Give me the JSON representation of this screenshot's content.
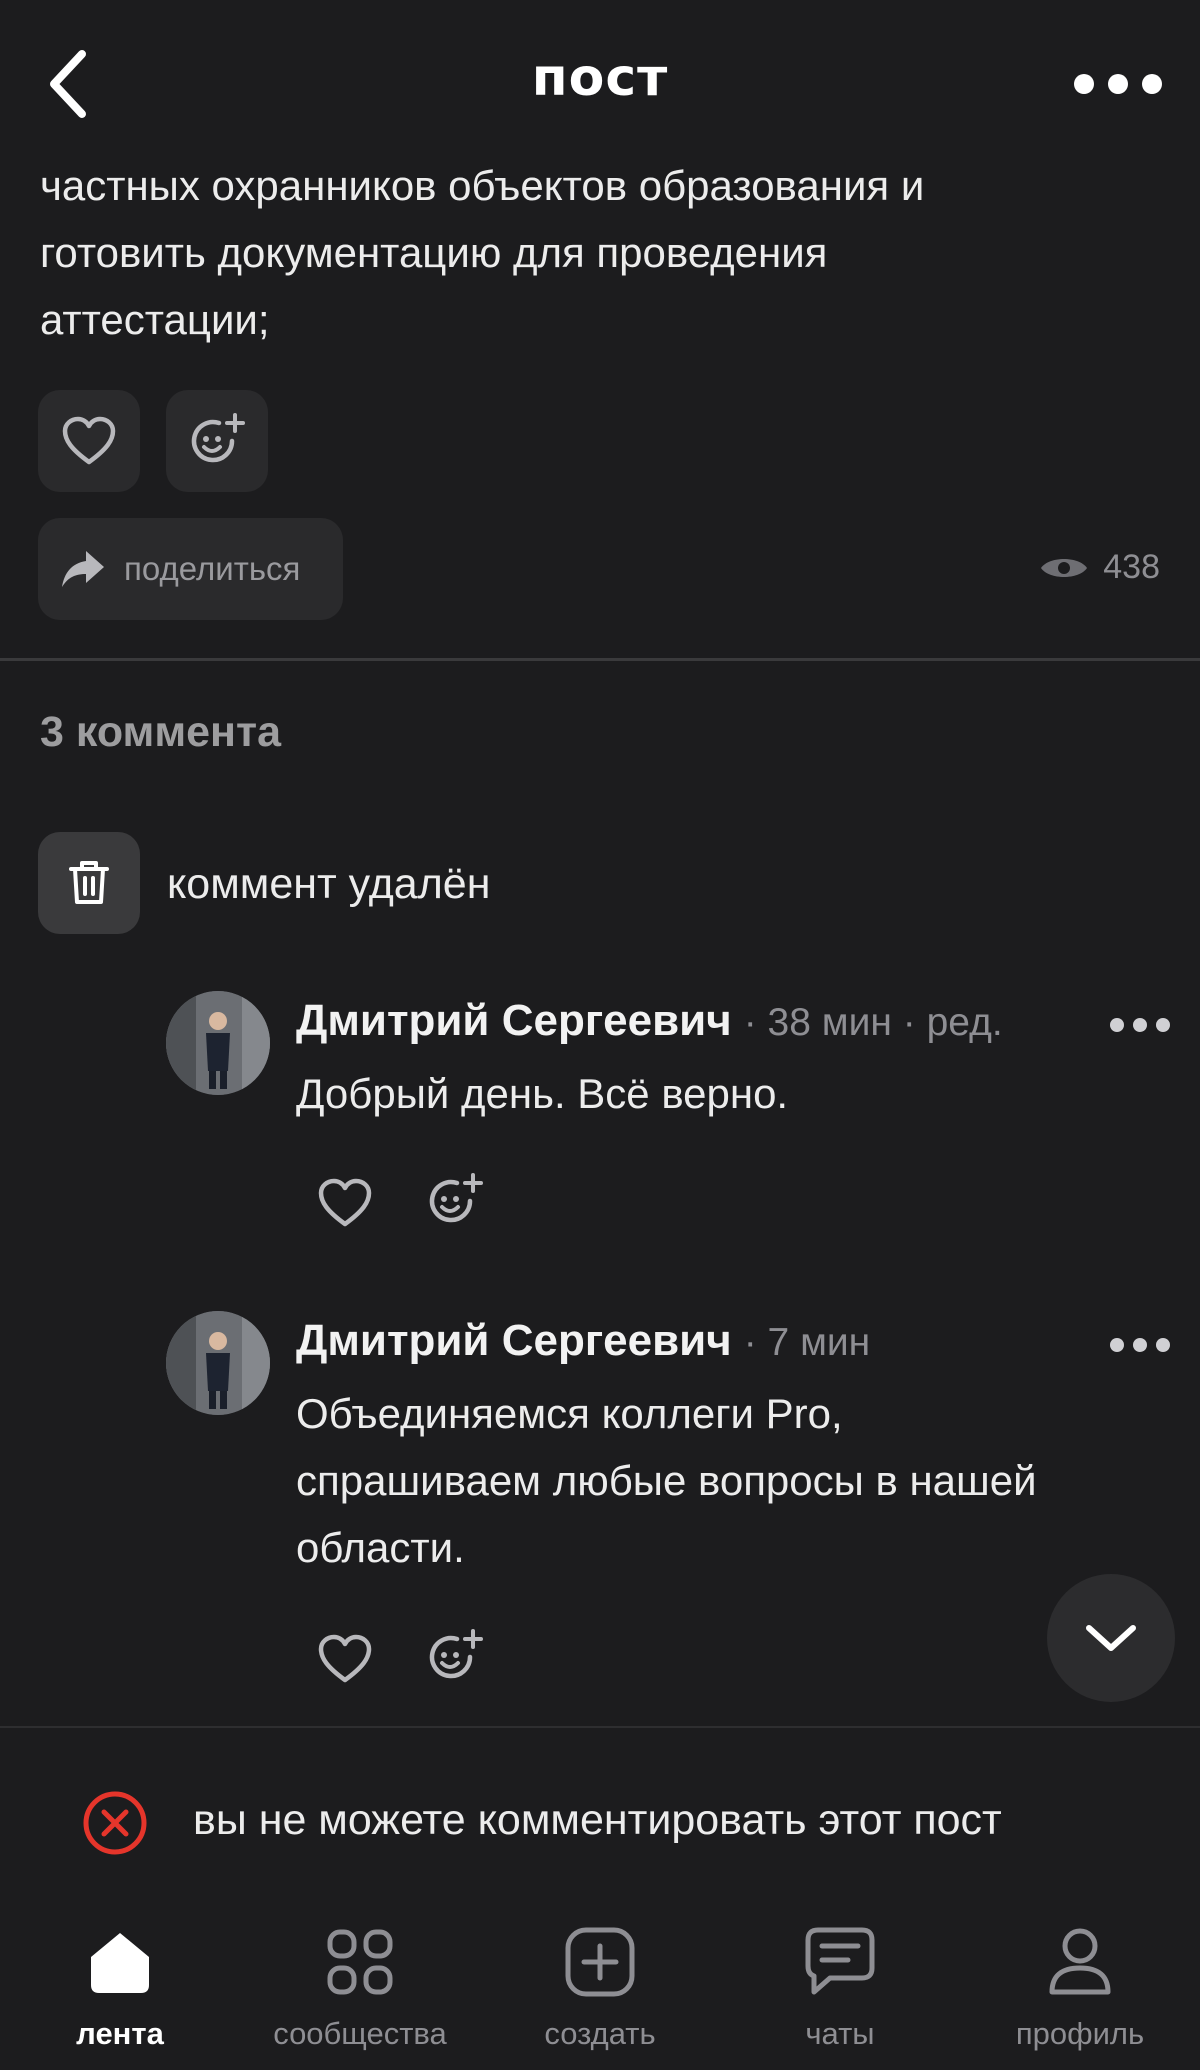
{
  "header": {
    "title": "пост",
    "back_icon": "chevron-left-icon",
    "more_icon": "more-dots-icon"
  },
  "post": {
    "text_lines": [
      "частных охранников объектов образования и",
      "готовить документацию для проведения",
      "аттестации;"
    ],
    "share_label": "поделиться",
    "views": "438"
  },
  "comments": {
    "count_label": "3 коммента",
    "deleted_label": "коммент удалён",
    "items": [
      {
        "author": "Дмитрий Сергеевич",
        "meta": "· 38 мин · ред.",
        "lines": [
          "Добрый день. Всё верно."
        ]
      },
      {
        "author": "Дмитрий Сергеевич",
        "meta": "· 7 мин",
        "lines": [
          "Объединяемся коллеги Pro,",
          "спрашиваем любые вопросы в нашей",
          "области."
        ]
      }
    ]
  },
  "banner": {
    "text": "вы не можете комментировать этот пост",
    "icon": "error-x-circle-icon",
    "icon_color": "#e5352b"
  },
  "nav": {
    "items": [
      {
        "label": "лента",
        "icon": "home-icon",
        "active": true
      },
      {
        "label": "сообщества",
        "icon": "grid-icon",
        "active": false
      },
      {
        "label": "создать",
        "icon": "plus-square-icon",
        "active": false
      },
      {
        "label": "чаты",
        "icon": "chat-icon",
        "active": false
      },
      {
        "label": "профиль",
        "icon": "profile-icon",
        "active": false
      }
    ]
  },
  "colors": {
    "background": "#1c1c1e",
    "surface": "#2a2a2c",
    "muted_text": "#8e8e93",
    "error": "#e5352b"
  }
}
